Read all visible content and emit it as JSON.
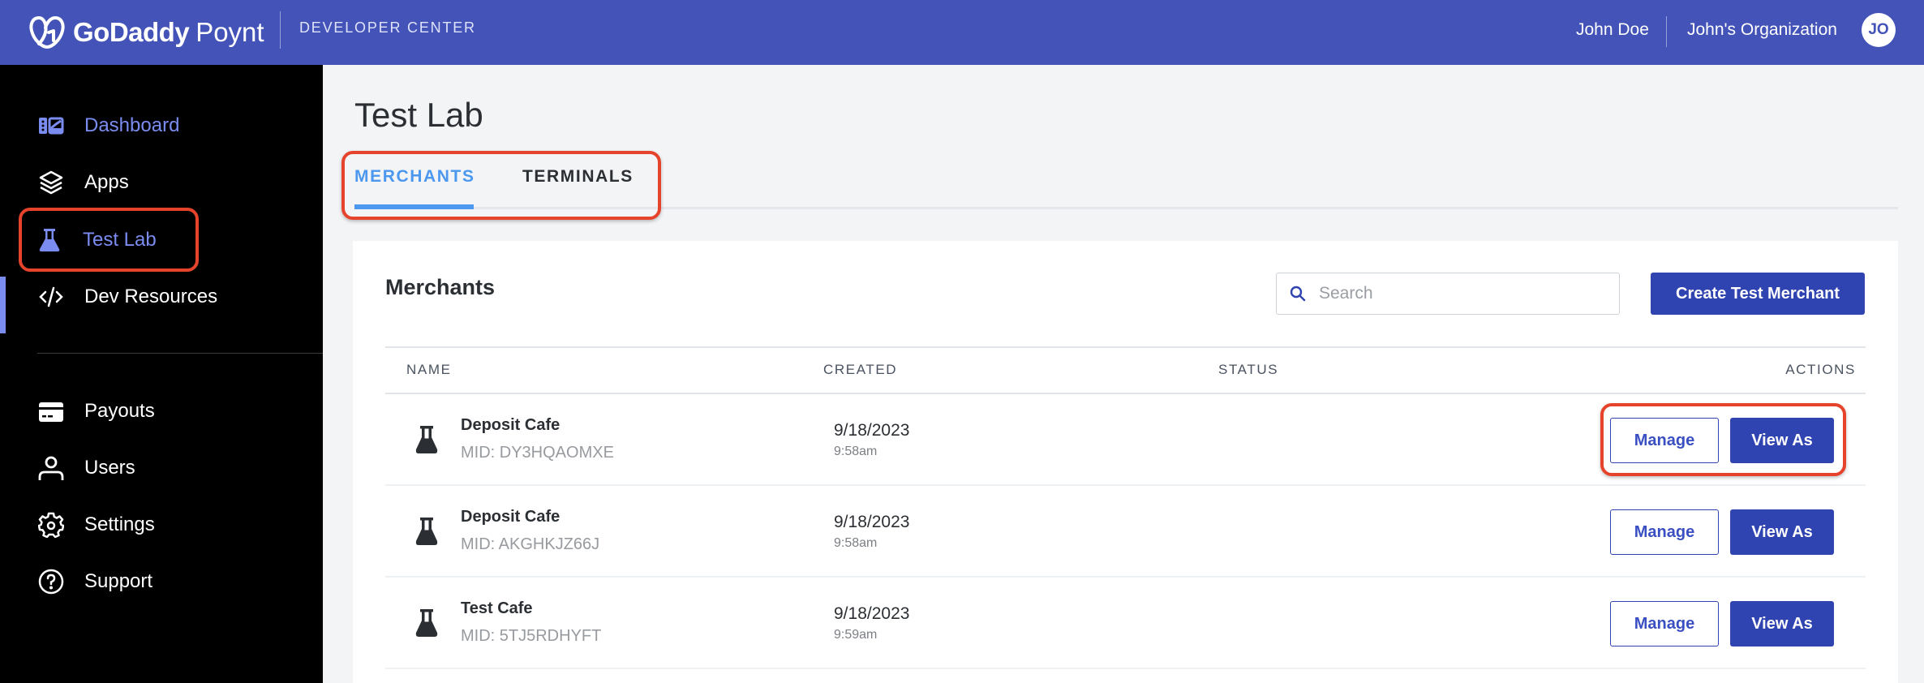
{
  "header": {
    "brand_primary": "GoDaddy",
    "brand_secondary": "Poynt",
    "section": "DEVELOPER CENTER",
    "user_name": "John Doe",
    "organization": "John's Organization",
    "avatar_initials": "JO"
  },
  "sidebar": {
    "items": [
      {
        "label": "Dashboard",
        "icon": "dashboard-icon"
      },
      {
        "label": "Apps",
        "icon": "layers-icon"
      },
      {
        "label": "Test Lab",
        "icon": "flask-icon",
        "active": true
      },
      {
        "label": "Dev Resources",
        "icon": "code-icon"
      },
      {
        "label": "Payouts",
        "icon": "credit-card-icon"
      },
      {
        "label": "Users",
        "icon": "user-icon"
      },
      {
        "label": "Settings",
        "icon": "gear-icon"
      },
      {
        "label": "Support",
        "icon": "help-circle-icon"
      }
    ]
  },
  "main": {
    "title": "Test Lab",
    "tabs": [
      {
        "label": "MERCHANTS",
        "active": true
      },
      {
        "label": "TERMINALS",
        "active": false
      }
    ],
    "card": {
      "title": "Merchants",
      "search_placeholder": "Search",
      "search_value": "",
      "create_button": "Create Test Merchant",
      "columns": [
        "NAME",
        "CREATED",
        "STATUS",
        "ACTIONS"
      ],
      "rows": [
        {
          "name": "Deposit Cafe",
          "mid": "MID: DY3HQAOMXE",
          "date": "9/18/2023",
          "time": "9:58am",
          "status": "",
          "manage": "Manage",
          "view_as": "View As"
        },
        {
          "name": "Deposit Cafe",
          "mid": "MID: AKGHKJZ66J",
          "date": "9/18/2023",
          "time": "9:58am",
          "status": "",
          "manage": "Manage",
          "view_as": "View As"
        },
        {
          "name": "Test Cafe",
          "mid": "MID: 5TJ5RDHYFT",
          "date": "9/18/2023",
          "time": "9:59am",
          "status": "",
          "manage": "Manage",
          "view_as": "View As"
        }
      ]
    }
  },
  "colors": {
    "header_bg": "#4353b8",
    "sidebar_bg": "#000000",
    "accent": "#7b8cf0",
    "tab_active": "#4b98ee",
    "primary_button": "#2f44b0",
    "annotation_red": "#e5432b"
  }
}
